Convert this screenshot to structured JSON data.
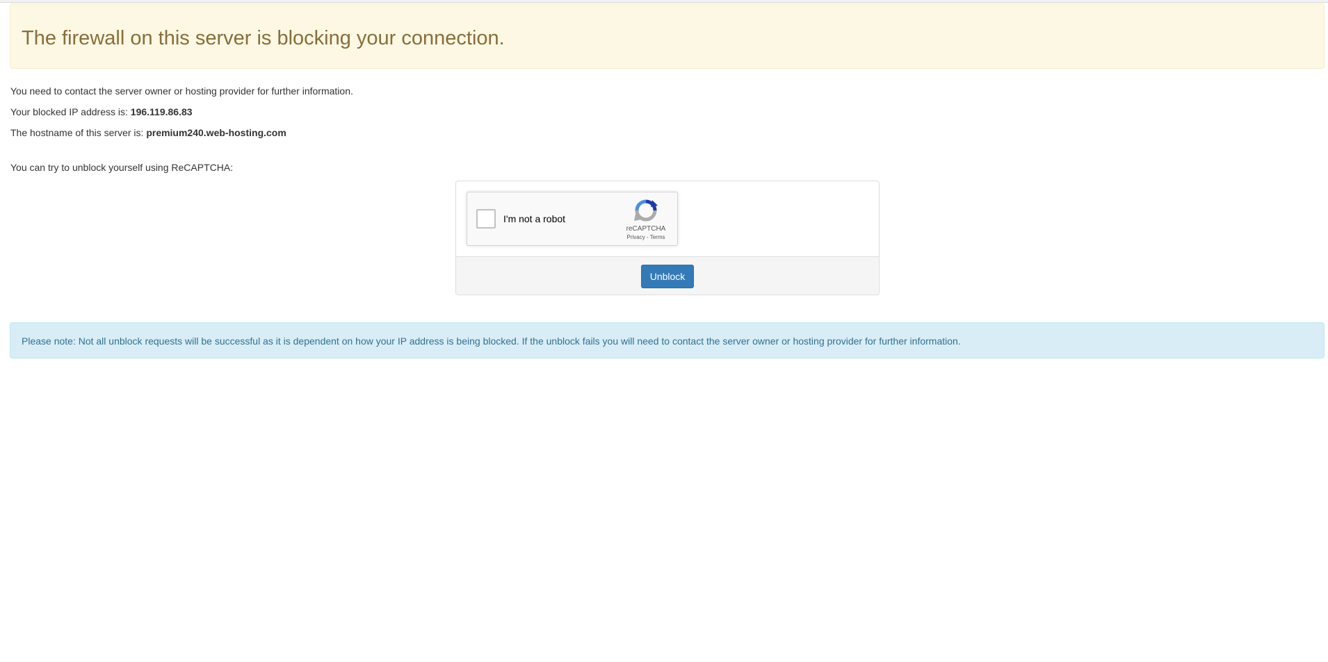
{
  "alert": {
    "title": "The firewall on this server is blocking your connection."
  },
  "info": {
    "contact_text": "You need to contact the server owner or hosting provider for further information.",
    "ip_label": "Your blocked IP address is: ",
    "ip_value": "196.119.86.83",
    "hostname_label": "The hostname of this server is: ",
    "hostname_value": "premium240.web-hosting.com",
    "unblock_prompt": "You can try to unblock yourself using ReCAPTCHA:"
  },
  "recaptcha": {
    "checkbox_label": "I'm not a robot",
    "brand": "reCAPTCHA",
    "privacy": "Privacy",
    "separator": " - ",
    "terms": "Terms",
    "logo_icon": "recaptcha-logo-icon"
  },
  "form": {
    "unblock_label": "Unblock"
  },
  "note": {
    "text": "Please note: Not all unblock requests will be successful as it is dependent on how your IP address is being blocked. If the unblock fails you will need to contact the server owner or hosting provider for further information."
  },
  "colors": {
    "warning_bg": "#fcf8e3",
    "warning_text": "#8a6d3b",
    "info_bg": "#d9edf7",
    "info_text": "#31708f",
    "button_primary": "#337ab7"
  }
}
